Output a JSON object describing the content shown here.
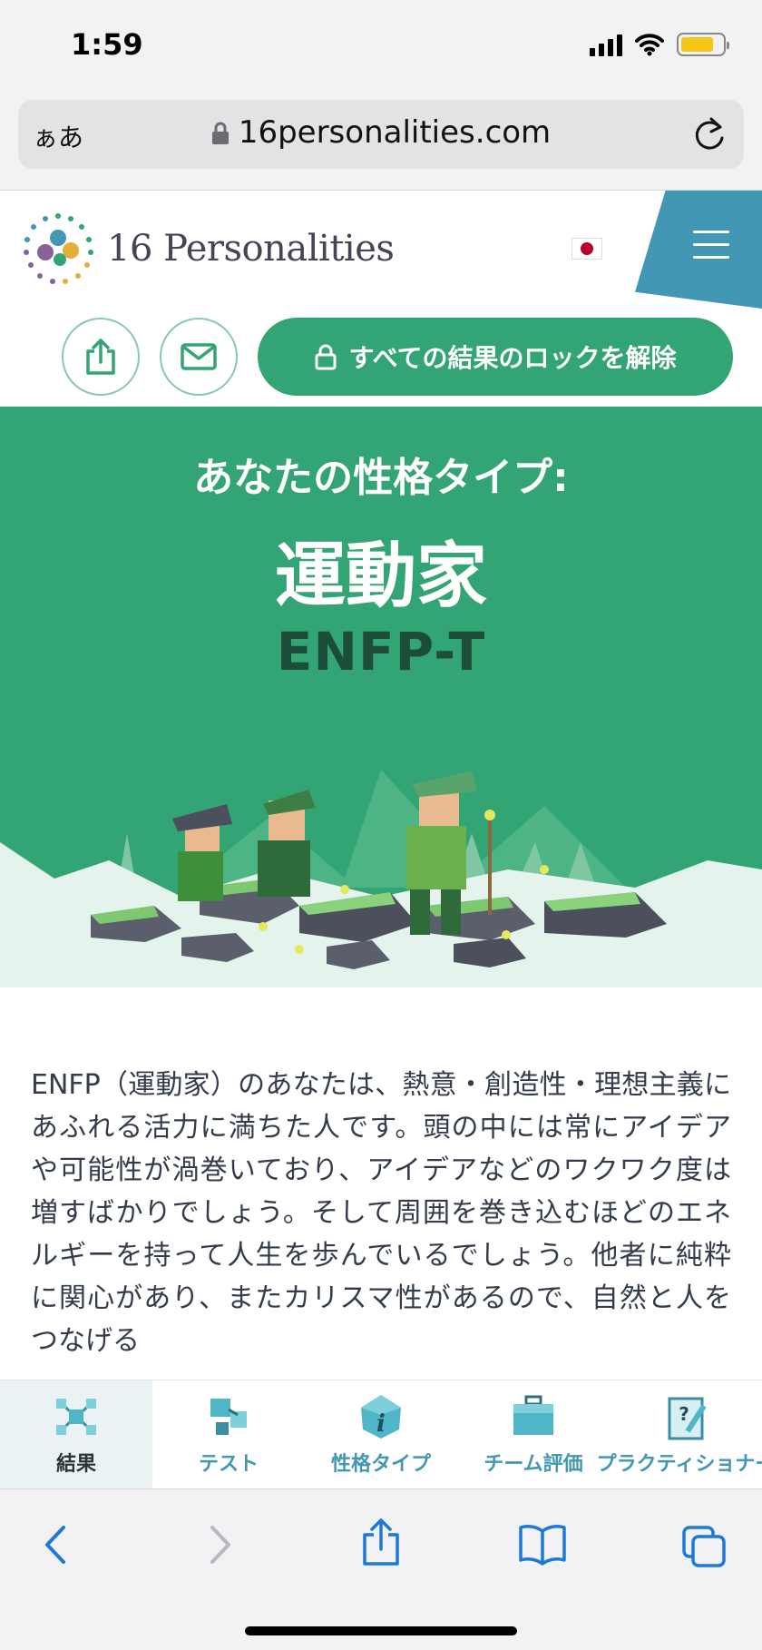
{
  "status_bar": {
    "time": "1:59"
  },
  "url_bar": {
    "format_label": "ぁあ",
    "domain": "16personalities.com"
  },
  "header": {
    "logo_text": "16 Personalities"
  },
  "actions": {
    "unlock_label": "すべての結果のロックを解除"
  },
  "hero": {
    "label": "あなたの性格タイプ:",
    "type_name": "運動家",
    "type_code": "ENFP-T"
  },
  "description": "ENFP（運動家）のあなたは、熱意・創造性・理想主義にあふれる活力に満ちた人です。頭の中には常にアイデアや可能性が渦巻いており、アイデアなどのワクワク度は増すばかりでしょう。そして周囲を巻き込むほどのエネルギーを持って人生を歩んでいるでしょう。他者に純粋に関心があり、またカリスマ性があるので、自然と人をつなげる",
  "bottom_nav": {
    "items": [
      {
        "label": "結果",
        "icon": "molecule-icon",
        "active": true
      },
      {
        "label": "テスト",
        "icon": "cubes-icon",
        "active": false
      },
      {
        "label": "性格タイプ",
        "icon": "info-gem-icon",
        "active": false
      },
      {
        "label": "チーム評価",
        "icon": "briefcase-icon",
        "active": false
      },
      {
        "label": "プラクティショナー",
        "icon": "clipboard-pen-icon",
        "active": false
      }
    ]
  },
  "colors": {
    "brand_green": "#33a474",
    "brand_blue": "#4298b4",
    "dark_green_text": "#1b4d38"
  }
}
